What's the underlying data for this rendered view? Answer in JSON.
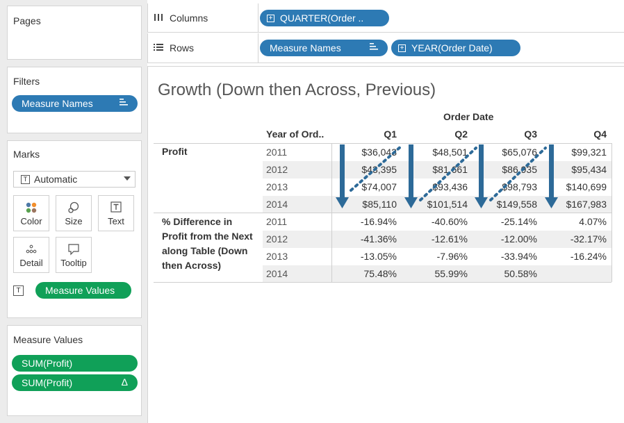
{
  "left_panel": {
    "pages": {
      "title": "Pages"
    },
    "filters": {
      "title": "Filters",
      "pill": "Measure Names"
    },
    "marks": {
      "title": "Marks",
      "mark_type": "Automatic",
      "buttons": [
        {
          "label": "Color",
          "icon": "color-dots-icon"
        },
        {
          "label": "Size",
          "icon": "size-icon"
        },
        {
          "label": "Text",
          "icon": "text-icon"
        },
        {
          "label": "Detail",
          "icon": "detail-icon"
        },
        {
          "label": "Tooltip",
          "icon": "tooltip-icon"
        }
      ],
      "text_pill": "Measure Values"
    },
    "measure_values": {
      "title": "Measure Values",
      "pills": [
        {
          "label": "SUM(Profit)",
          "badge": ""
        },
        {
          "label": "SUM(Profit)",
          "badge": "Δ"
        }
      ]
    }
  },
  "shelves": {
    "columns": {
      "label": "Columns",
      "pills": [
        "QUARTER(Order .."
      ]
    },
    "rows": {
      "label": "Rows",
      "pills": [
        "Measure Names",
        "YEAR(Order Date)"
      ]
    }
  },
  "viz": {
    "title": "Growth (Down then Across, Previous)",
    "column_group_header": "Order Date",
    "row_dim_header": "Year of Ord..",
    "quarters": [
      "Q1",
      "Q2",
      "Q3",
      "Q4"
    ],
    "years": [
      "2011",
      "2012",
      "2013",
      "2014"
    ],
    "groups": [
      {
        "label": "Profit",
        "rows": [
          [
            "$36,043",
            "$48,501",
            "$65,076",
            "$99,321"
          ],
          [
            "$43,395",
            "$81,661",
            "$86,935",
            "$95,434"
          ],
          [
            "$74,007",
            "$93,436",
            "$98,793",
            "$140,699"
          ],
          [
            "$85,110",
            "$101,514",
            "$149,558",
            "$167,983"
          ]
        ]
      },
      {
        "label": "% Difference in Profit from the Next along Table (Down then Across)",
        "label_lines": [
          "% Difference in",
          "Profit from the Next",
          "along Table (Down",
          "then Across)"
        ],
        "rows": [
          [
            "-16.94%",
            "-40.60%",
            "-25.14%",
            "4.07%"
          ],
          [
            "-41.36%",
            "-12.61%",
            "-12.00%",
            "-32.17%"
          ],
          [
            "-13.05%",
            "-7.96%",
            "-33.94%",
            "-16.24%"
          ],
          [
            "75.48%",
            "55.99%",
            "50.58%",
            ""
          ]
        ]
      }
    ],
    "arrow_color": "#2d6a98"
  }
}
